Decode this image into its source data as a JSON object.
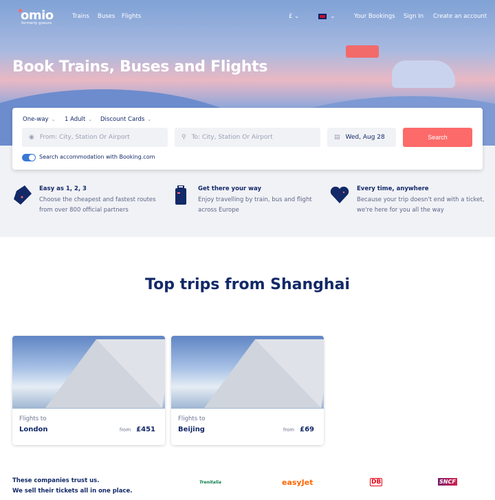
{
  "nav": {
    "logo": "omio",
    "formerly": "formerly goeuro",
    "links": [
      "Trains",
      "Buses",
      "Flights"
    ],
    "currency": "£",
    "language": "English (UK)",
    "your_bookings": "Your Bookings",
    "sign_in": "Sign In",
    "create_account": "Create an account"
  },
  "hero": {
    "title": "Book Trains, Buses and Flights"
  },
  "search": {
    "trip_type": "One-way",
    "passengers": "1 Adult",
    "discount": "Discount Cards",
    "from_placeholder": "From: City, Station Or Airport",
    "to_placeholder": "To: City, Station Or Airport",
    "date": "Wed, Aug 28",
    "button": "Search",
    "accommodation_label": "Search accommodation with Booking.com",
    "accommodation_enabled": true
  },
  "features": [
    {
      "title": "Easy as 1, 2, 3",
      "desc": "Choose the cheapest and fastest routes from over 800 official partners",
      "icon": "ticket-icon"
    },
    {
      "title": "Get there your way",
      "desc": "Enjoy travelling by train, bus and flight across Europe",
      "icon": "suitcase-icon"
    },
    {
      "title": "Every time, anywhere",
      "desc": "Because your trip doesn't end with a ticket, we're here for you all the way",
      "icon": "heart-icon"
    }
  ],
  "top_trips": {
    "title": "Top trips from Shanghai",
    "items": [
      {
        "label": "Flights to",
        "city": "London",
        "from": "from",
        "price": "£451"
      },
      {
        "label": "Flights to",
        "city": "Beijing",
        "from": "from",
        "price": "£69"
      }
    ]
  },
  "trust": {
    "line1": "These companies trust us.",
    "line2": "We sell their tickets all in one place.",
    "logos": [
      "Trenitalia",
      "easyJet",
      "DB",
      "SNCF"
    ]
  },
  "colors": {
    "accent": "#fc6a6a",
    "navy": "#132968",
    "toggle": "#3a78d6",
    "easyjet": "#ff6600",
    "db": "#ec0016"
  }
}
